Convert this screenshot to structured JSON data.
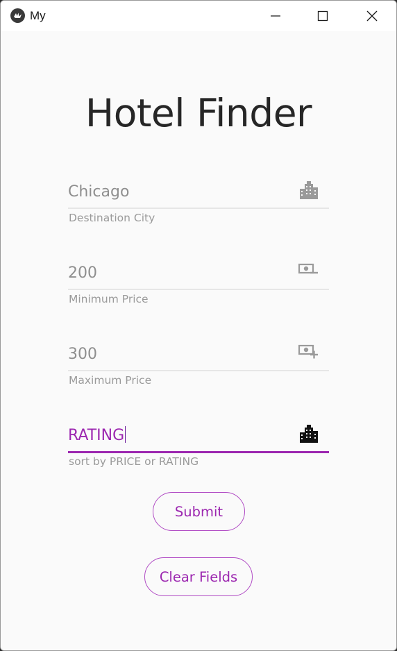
{
  "window": {
    "title": "My"
  },
  "heading": "Hotel Finder",
  "fields": [
    {
      "value": "Chicago",
      "helper": "Destination City",
      "icon": "city-icon",
      "active": false
    },
    {
      "value": "200",
      "helper": "Minimum Price",
      "icon": "cash-minus-icon",
      "active": false
    },
    {
      "value": "300",
      "helper": "Maximum Price",
      "icon": "cash-plus-icon",
      "active": false
    },
    {
      "value": "RATING",
      "helper": "sort by PRICE or RATING",
      "icon": "city-icon",
      "active": true
    }
  ],
  "buttons": {
    "submit": "Submit",
    "clear": "Clear Fields"
  },
  "colors": {
    "accent": "#9c27b0",
    "text_muted": "#8f8f8f",
    "heading": "#262626",
    "background": "#fafafa"
  }
}
